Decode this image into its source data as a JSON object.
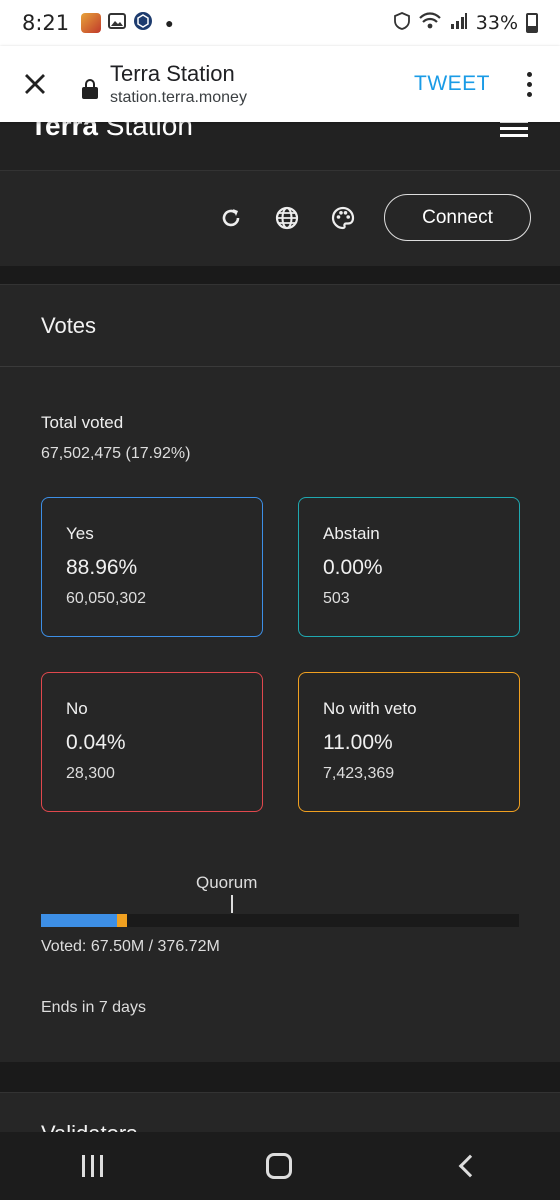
{
  "status_bar": {
    "time": "8:21",
    "battery": "33%"
  },
  "tab": {
    "title": "Terra Station",
    "url": "station.terra.money",
    "tweet_label": "TWEET"
  },
  "site": {
    "logo_bold": "Terra",
    "logo_rest": " Station",
    "connect_label": "Connect"
  },
  "votes": {
    "heading": "Votes",
    "total_label": "Total voted",
    "total_value": "67,502,475 (17.92%)",
    "options": [
      {
        "label": "Yes",
        "percent": "88.96%",
        "count": "60,050,302",
        "color": "#3d8fe6"
      },
      {
        "label": "Abstain",
        "percent": "0.00%",
        "count": "503",
        "color": "#1fa8b0"
      },
      {
        "label": "No",
        "percent": "0.04%",
        "count": "28,300",
        "color": "#e0484d"
      },
      {
        "label": "No with veto",
        "percent": "11.00%",
        "count": "7,423,369",
        "color": "#f0a020"
      }
    ],
    "quorum_label": "Quorum",
    "quorum_fraction": 0.4,
    "voted_fraction": 0.1792,
    "yes_share": 0.8896,
    "veto_share": 0.11,
    "voted_text": "Voted: 67.50M / 376.72M",
    "ends_text": "Ends in 7 days"
  },
  "next_section": {
    "title": "Validators"
  }
}
